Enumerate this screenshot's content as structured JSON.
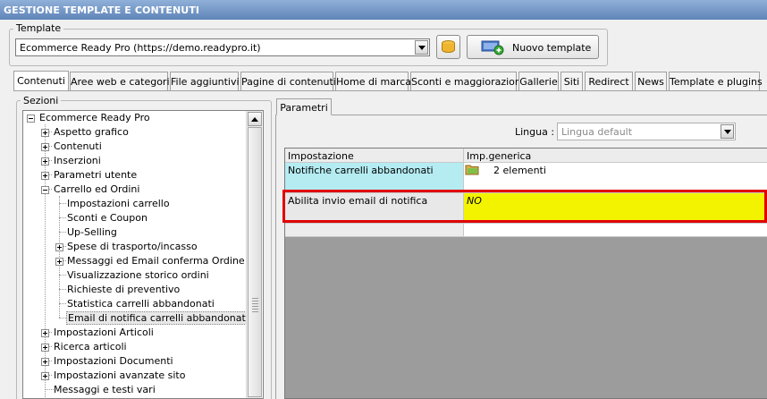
{
  "window": {
    "title": "GESTIONE TEMPLATE E CONTENUTI"
  },
  "template_group": {
    "label": "Template",
    "selected": "Ecommerce Ready Pro (https://demo.readypro.it)",
    "new_button_label": "Nuovo template"
  },
  "tabs": [
    {
      "label": "Contenuti",
      "active": true
    },
    {
      "label": "Aree web e categorie"
    },
    {
      "label": "File aggiuntivi"
    },
    {
      "label": "Pagine di contenuti"
    },
    {
      "label": "Home di marca"
    },
    {
      "label": "Sconti e maggiorazioni"
    },
    {
      "label": "Gallerie"
    },
    {
      "label": "Siti"
    },
    {
      "label": "Redirect"
    },
    {
      "label": "News"
    },
    {
      "label": "Template e plugins"
    }
  ],
  "sections": {
    "label": "Sezioni",
    "tree": [
      {
        "label": "Ecommerce Ready Pro",
        "level": 0,
        "state": "expanded"
      },
      {
        "label": "Aspetto grafico",
        "level": 1,
        "state": "collapsed"
      },
      {
        "label": "Contenuti",
        "level": 1,
        "state": "collapsed"
      },
      {
        "label": "Inserzioni",
        "level": 1,
        "state": "collapsed"
      },
      {
        "label": "Parametri utente",
        "level": 1,
        "state": "collapsed"
      },
      {
        "label": "Carrello ed Ordini",
        "level": 1,
        "state": "expanded"
      },
      {
        "label": "Impostazioni carrello",
        "level": 2,
        "state": "leaf"
      },
      {
        "label": "Sconti e Coupon",
        "level": 2,
        "state": "leaf"
      },
      {
        "label": "Up-Selling",
        "level": 2,
        "state": "leaf"
      },
      {
        "label": "Spese di trasporto/incasso",
        "level": 2,
        "state": "collapsed"
      },
      {
        "label": "Messaggi ed Email conferma Ordine",
        "level": 2,
        "state": "collapsed"
      },
      {
        "label": "Visualizzazione storico ordini",
        "level": 2,
        "state": "leaf"
      },
      {
        "label": "Richieste di preventivo",
        "level": 2,
        "state": "leaf"
      },
      {
        "label": "Statistica carrelli abbandonati",
        "level": 2,
        "state": "leaf"
      },
      {
        "label": "Email di notifica carrelli abbandonati",
        "level": 2,
        "state": "leaf",
        "selected": true
      },
      {
        "label": "Impostazioni Articoli",
        "level": 1,
        "state": "collapsed"
      },
      {
        "label": "Ricerca articoli",
        "level": 1,
        "state": "collapsed"
      },
      {
        "label": "Impostazioni Documenti",
        "level": 1,
        "state": "collapsed"
      },
      {
        "label": "Impostazioni avanzate sito",
        "level": 1,
        "state": "collapsed"
      },
      {
        "label": "Messaggi e testi vari",
        "level": 1,
        "state": "leaf"
      }
    ]
  },
  "params": {
    "tab_label": "Parametri",
    "language_label": "Lingua :",
    "language_value": "Lingua default",
    "columns": [
      "Impostazione",
      "Imp.generica"
    ],
    "rows": [
      {
        "setting": "Notifiche carrelli abbandonati",
        "value": "2 elementi"
      },
      {
        "setting": "Abilita invio email di notifica",
        "value": "NO"
      }
    ]
  },
  "colors": {
    "title_bar": "#6f93c4",
    "cyan_cell": "#b4ecf2",
    "yellow_cell": "#f3f300",
    "highlight_border": "#e00000"
  }
}
